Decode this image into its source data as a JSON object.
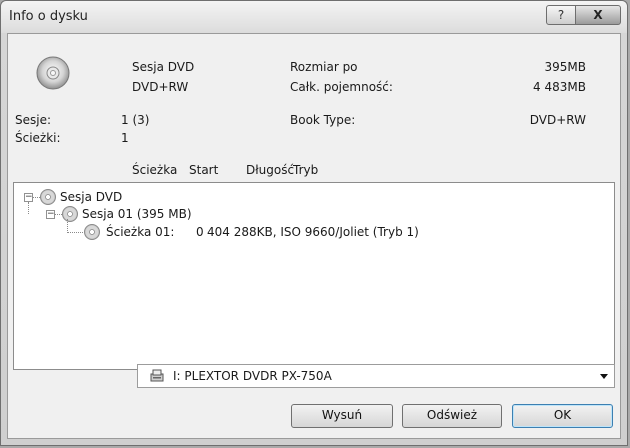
{
  "window": {
    "title": "Info o dysku",
    "help_label": "?",
    "close_label": "X"
  },
  "disc_info": {
    "session_type": "Sesja DVD",
    "media_type": "DVD+RW",
    "size_after_label": "Rozmiar po",
    "size_after_value": "395MB",
    "total_capacity_label": "Całk. pojemność:",
    "total_capacity_value": "4 483MB",
    "sessions_label": "Sesje:",
    "sessions_value": "1 (3)",
    "tracks_label": "Ścieżki:",
    "tracks_value": "1",
    "book_type_label": "Book Type:",
    "book_type_value": "DVD+RW"
  },
  "columns": {
    "track": "Ścieżka",
    "start": "Start",
    "length": "Długość",
    "mode": "Tryb"
  },
  "tree": {
    "root": {
      "label": "Sesja DVD",
      "expander": "−"
    },
    "session": {
      "label": "Sesja 01 (395 MB)",
      "expander": "−"
    },
    "track": {
      "label": "Ścieżka 01:",
      "start": "0",
      "details": "404 288KB, ISO 9660/Joliet (Tryb 1)"
    }
  },
  "drive": {
    "selected": "I: PLEXTOR DVDR  PX-750A"
  },
  "buttons": {
    "eject": "Wysuń",
    "refresh": "Odśwież",
    "ok": "OK"
  }
}
